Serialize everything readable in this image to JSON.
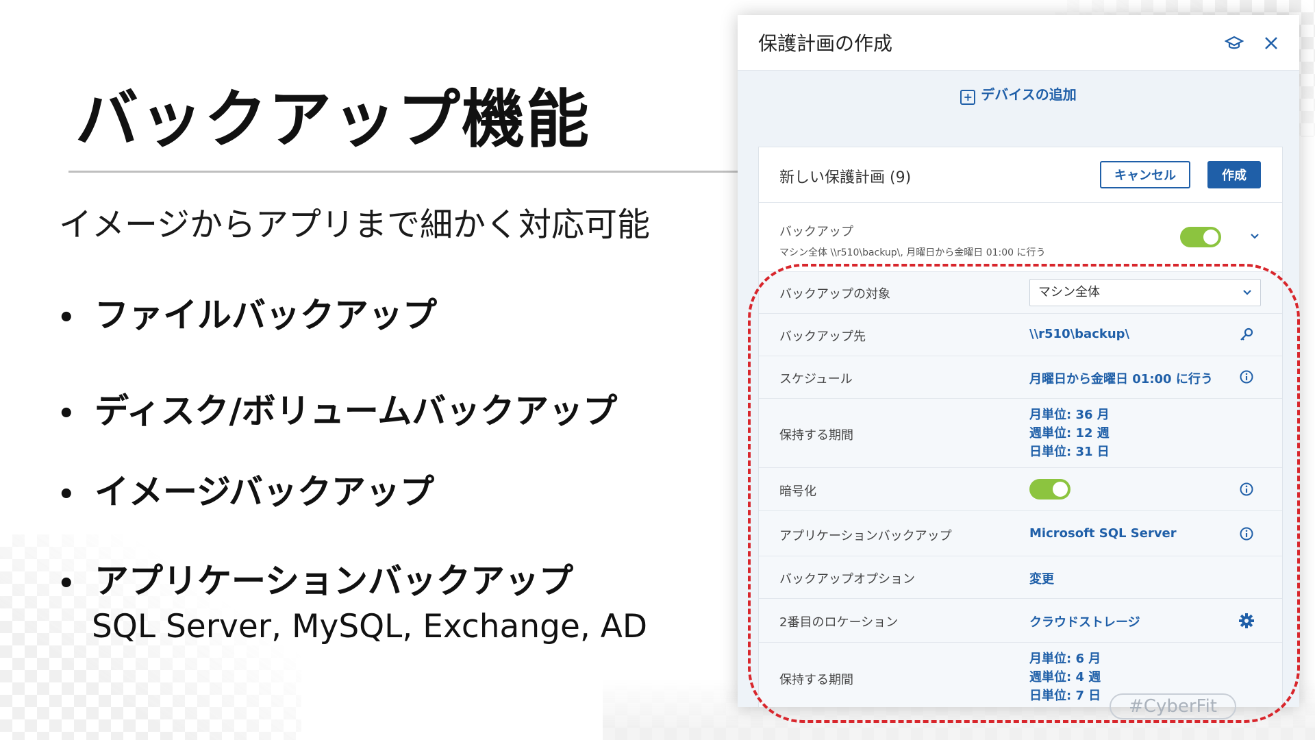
{
  "slide": {
    "title": "バックアップ機能",
    "subtitle": "イメージからアプリまで細かく対応可能",
    "bullets": [
      "ファイルバックアップ",
      "ディスク/ボリュームバックアップ",
      "イメージバックアップ",
      "アプリケーションバックアップ"
    ],
    "bullet_sub": "SQL Server, MySQL, Exchange, AD",
    "bullet_glyph": "•"
  },
  "dialog": {
    "title": "保護計画の作成",
    "add_device": "デバイスの追加",
    "plan": {
      "name": "新しい保護計画 (9)",
      "cancel_label": "キャンセル",
      "create_label": "作成"
    },
    "backup": {
      "label": "バックアップ",
      "description": "マシン全体 \\\\r510\\backup\\, 月曜日から金曜日 01:00 に行う",
      "enabled": true
    },
    "rows": {
      "target_label": "バックアップの対象",
      "target_value": "マシン全体",
      "dest_label": "バックアップ先",
      "dest_value": "\\\\r510\\backup\\",
      "schedule_label": "スケジュール",
      "schedule_value": "月曜日から金曜日 01:00 に行う",
      "retention_label": "保持する期間",
      "retention_lines": [
        "月単位: 36 月",
        "週単位: 12 週",
        "日単位: 31 日"
      ],
      "encryption_label": "暗号化",
      "encryption_enabled": true,
      "app_backup_label": "アプリケーションバックアップ",
      "app_backup_value": "Microsoft SQL Server",
      "options_label": "バックアップオプション",
      "options_value": "変更",
      "second_location_label": "2番目のロケーション",
      "second_location_value": "クラウドストレージ",
      "retention2_label": "保持する期間",
      "retention2_lines": [
        "月単位: 6 月",
        "週単位: 4 週",
        "日単位: 7 日"
      ]
    },
    "watermark": "#CyberFit"
  },
  "colors": {
    "accent": "#1f5fa8",
    "toggle_on": "#8cc43f",
    "highlight": "#d8262c"
  },
  "icons": [
    "plus-square-icon",
    "graduation-cap-icon",
    "close-icon",
    "chevron-down-icon",
    "key-icon",
    "info-icon",
    "gear-icon"
  ]
}
